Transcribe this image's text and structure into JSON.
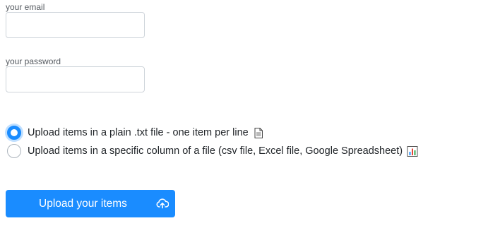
{
  "form": {
    "email_label": "your email",
    "email_value": "",
    "password_label": "your password",
    "password_value": ""
  },
  "upload_options": [
    {
      "label": "Upload items in a plain .txt file - one item per line",
      "icon": "document-icon",
      "checked": true
    },
    {
      "label": "Upload items in a specific column of a file (csv file, Excel file, Google Spreadsheet)",
      "icon": "bar-chart-icon",
      "checked": false
    }
  ],
  "upload_button": {
    "label": "Upload your items",
    "icon": "cloud-upload-icon"
  },
  "colors": {
    "accent": "#1a8cff",
    "input_border": "#ced4da"
  }
}
